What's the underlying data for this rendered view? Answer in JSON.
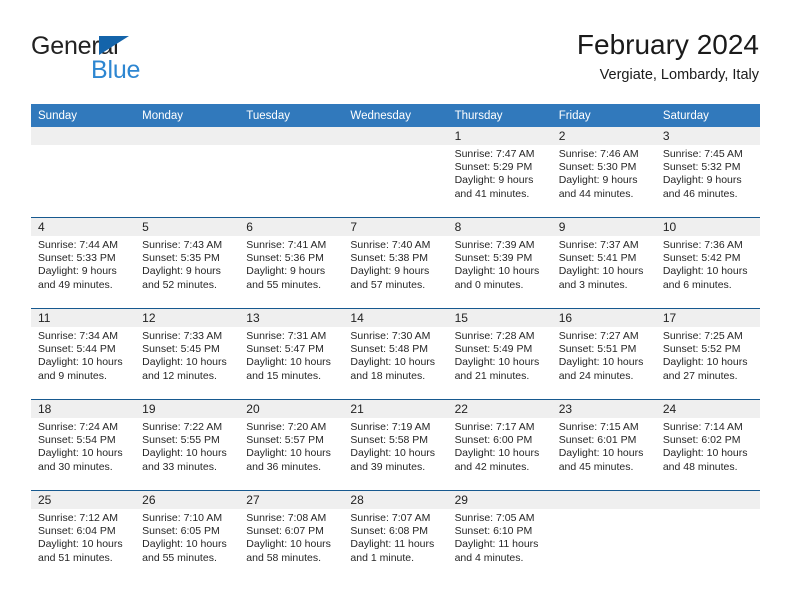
{
  "brand": {
    "name_part1": "General",
    "name_part2": "Blue",
    "triangle_color": "#1464aa",
    "blue_color": "#2d86d1"
  },
  "header": {
    "title": "February 2024",
    "subtitle": "Vergiate, Lombardy, Italy",
    "header_bg": "#3179bc",
    "separator_color": "#17598f",
    "daynum_bg": "#efefef"
  },
  "weekdays": [
    "Sunday",
    "Monday",
    "Tuesday",
    "Wednesday",
    "Thursday",
    "Friday",
    "Saturday"
  ],
  "weeks": [
    [
      {
        "day": "",
        "lines": []
      },
      {
        "day": "",
        "lines": []
      },
      {
        "day": "",
        "lines": []
      },
      {
        "day": "",
        "lines": []
      },
      {
        "day": "1",
        "lines": [
          "Sunrise: 7:47 AM",
          "Sunset: 5:29 PM",
          "Daylight: 9 hours",
          "and 41 minutes."
        ]
      },
      {
        "day": "2",
        "lines": [
          "Sunrise: 7:46 AM",
          "Sunset: 5:30 PM",
          "Daylight: 9 hours",
          "and 44 minutes."
        ]
      },
      {
        "day": "3",
        "lines": [
          "Sunrise: 7:45 AM",
          "Sunset: 5:32 PM",
          "Daylight: 9 hours",
          "and 46 minutes."
        ]
      }
    ],
    [
      {
        "day": "4",
        "lines": [
          "Sunrise: 7:44 AM",
          "Sunset: 5:33 PM",
          "Daylight: 9 hours",
          "and 49 minutes."
        ]
      },
      {
        "day": "5",
        "lines": [
          "Sunrise: 7:43 AM",
          "Sunset: 5:35 PM",
          "Daylight: 9 hours",
          "and 52 minutes."
        ]
      },
      {
        "day": "6",
        "lines": [
          "Sunrise: 7:41 AM",
          "Sunset: 5:36 PM",
          "Daylight: 9 hours",
          "and 55 minutes."
        ]
      },
      {
        "day": "7",
        "lines": [
          "Sunrise: 7:40 AM",
          "Sunset: 5:38 PM",
          "Daylight: 9 hours",
          "and 57 minutes."
        ]
      },
      {
        "day": "8",
        "lines": [
          "Sunrise: 7:39 AM",
          "Sunset: 5:39 PM",
          "Daylight: 10 hours",
          "and 0 minutes."
        ]
      },
      {
        "day": "9",
        "lines": [
          "Sunrise: 7:37 AM",
          "Sunset: 5:41 PM",
          "Daylight: 10 hours",
          "and 3 minutes."
        ]
      },
      {
        "day": "10",
        "lines": [
          "Sunrise: 7:36 AM",
          "Sunset: 5:42 PM",
          "Daylight: 10 hours",
          "and 6 minutes."
        ]
      }
    ],
    [
      {
        "day": "11",
        "lines": [
          "Sunrise: 7:34 AM",
          "Sunset: 5:44 PM",
          "Daylight: 10 hours",
          "and 9 minutes."
        ]
      },
      {
        "day": "12",
        "lines": [
          "Sunrise: 7:33 AM",
          "Sunset: 5:45 PM",
          "Daylight: 10 hours",
          "and 12 minutes."
        ]
      },
      {
        "day": "13",
        "lines": [
          "Sunrise: 7:31 AM",
          "Sunset: 5:47 PM",
          "Daylight: 10 hours",
          "and 15 minutes."
        ]
      },
      {
        "day": "14",
        "lines": [
          "Sunrise: 7:30 AM",
          "Sunset: 5:48 PM",
          "Daylight: 10 hours",
          "and 18 minutes."
        ]
      },
      {
        "day": "15",
        "lines": [
          "Sunrise: 7:28 AM",
          "Sunset: 5:49 PM",
          "Daylight: 10 hours",
          "and 21 minutes."
        ]
      },
      {
        "day": "16",
        "lines": [
          "Sunrise: 7:27 AM",
          "Sunset: 5:51 PM",
          "Daylight: 10 hours",
          "and 24 minutes."
        ]
      },
      {
        "day": "17",
        "lines": [
          "Sunrise: 7:25 AM",
          "Sunset: 5:52 PM",
          "Daylight: 10 hours",
          "and 27 minutes."
        ]
      }
    ],
    [
      {
        "day": "18",
        "lines": [
          "Sunrise: 7:24 AM",
          "Sunset: 5:54 PM",
          "Daylight: 10 hours",
          "and 30 minutes."
        ]
      },
      {
        "day": "19",
        "lines": [
          "Sunrise: 7:22 AM",
          "Sunset: 5:55 PM",
          "Daylight: 10 hours",
          "and 33 minutes."
        ]
      },
      {
        "day": "20",
        "lines": [
          "Sunrise: 7:20 AM",
          "Sunset: 5:57 PM",
          "Daylight: 10 hours",
          "and 36 minutes."
        ]
      },
      {
        "day": "21",
        "lines": [
          "Sunrise: 7:19 AM",
          "Sunset: 5:58 PM",
          "Daylight: 10 hours",
          "and 39 minutes."
        ]
      },
      {
        "day": "22",
        "lines": [
          "Sunrise: 7:17 AM",
          "Sunset: 6:00 PM",
          "Daylight: 10 hours",
          "and 42 minutes."
        ]
      },
      {
        "day": "23",
        "lines": [
          "Sunrise: 7:15 AM",
          "Sunset: 6:01 PM",
          "Daylight: 10 hours",
          "and 45 minutes."
        ]
      },
      {
        "day": "24",
        "lines": [
          "Sunrise: 7:14 AM",
          "Sunset: 6:02 PM",
          "Daylight: 10 hours",
          "and 48 minutes."
        ]
      }
    ],
    [
      {
        "day": "25",
        "lines": [
          "Sunrise: 7:12 AM",
          "Sunset: 6:04 PM",
          "Daylight: 10 hours",
          "and 51 minutes."
        ]
      },
      {
        "day": "26",
        "lines": [
          "Sunrise: 7:10 AM",
          "Sunset: 6:05 PM",
          "Daylight: 10 hours",
          "and 55 minutes."
        ]
      },
      {
        "day": "27",
        "lines": [
          "Sunrise: 7:08 AM",
          "Sunset: 6:07 PM",
          "Daylight: 10 hours",
          "and 58 minutes."
        ]
      },
      {
        "day": "28",
        "lines": [
          "Sunrise: 7:07 AM",
          "Sunset: 6:08 PM",
          "Daylight: 11 hours",
          "and 1 minute."
        ]
      },
      {
        "day": "29",
        "lines": [
          "Sunrise: 7:05 AM",
          "Sunset: 6:10 PM",
          "Daylight: 11 hours",
          "and 4 minutes."
        ]
      },
      {
        "day": "",
        "lines": []
      },
      {
        "day": "",
        "lines": []
      }
    ]
  ]
}
